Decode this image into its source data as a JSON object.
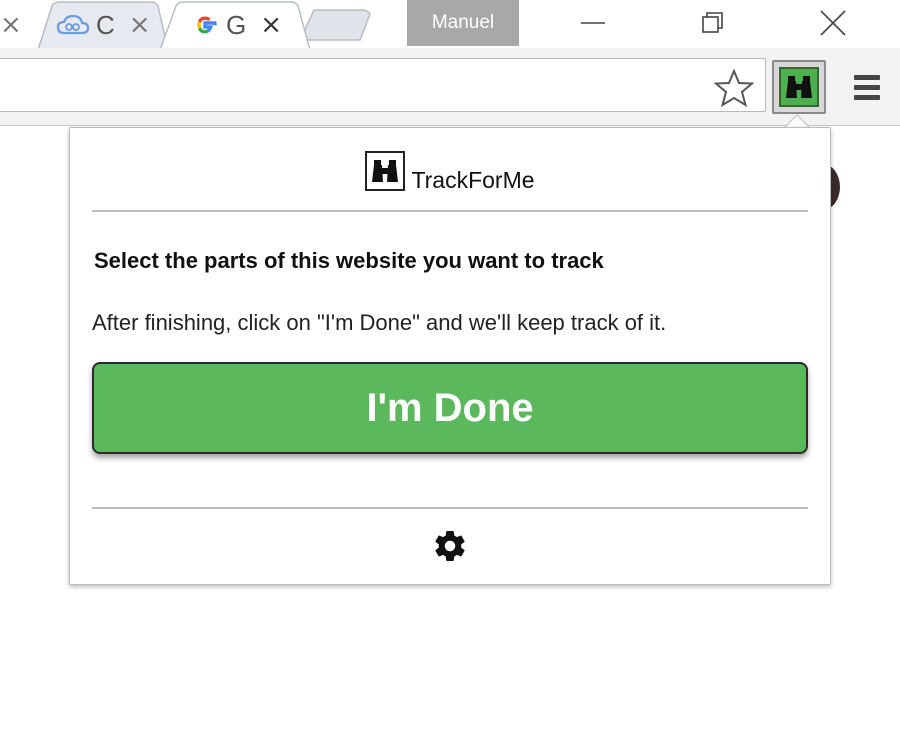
{
  "browser": {
    "tabs": [
      {
        "label": "",
        "close": "×"
      },
      {
        "label": "C",
        "close": "×"
      },
      {
        "label": "G",
        "close": "×"
      }
    ],
    "profile_name": "Manuel"
  },
  "popup": {
    "title": "TrackForMe",
    "instruction_bold": "Select the parts of this website you want to track",
    "instruction_text": "After finishing, click on \"I'm Done\" and we'll keep track of it.",
    "done_button": "I'm Done"
  },
  "icons": {
    "star": "star-icon",
    "extension": "binoculars-icon",
    "menu": "hamburger-menu-icon",
    "settings": "gear-icon",
    "cloud": "cloud-icon",
    "google": "google-g-icon"
  },
  "colors": {
    "accent_green": "#5cb85c",
    "extension_green": "#4caf50",
    "profile_badge": "#a8a8a8"
  }
}
